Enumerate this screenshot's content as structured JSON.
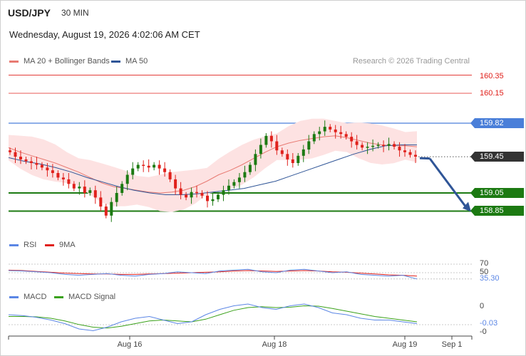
{
  "header": {
    "pair": "USD/JPY",
    "timeframe": "30 MIN",
    "datetime": "Wednesday, August 19, 2026 4:02:06 AM CET",
    "credit": "Research © 2026 Trading Central"
  },
  "legend_main": [
    {
      "label": "MA 20 + Bollinger Bands",
      "color": "#e87a72"
    },
    {
      "label": "MA 50",
      "color": "#2f5597"
    }
  ],
  "legend_rsi": [
    {
      "label": "RSI",
      "color": "#5b86e5"
    },
    {
      "label": "9MA",
      "color": "#e0211c"
    }
  ],
  "legend_macd": [
    {
      "label": "MACD",
      "color": "#5b86e5"
    },
    {
      "label": "MACD Signal",
      "color": "#3aa11a"
    }
  ],
  "levels": {
    "r2": "160.35",
    "r1": "160.15",
    "pivot": "159.82",
    "last": "159.45",
    "s1": "159.05",
    "s2": "158.85"
  },
  "rsi_panel": {
    "level_70": "70",
    "level_50": "50",
    "value": "35.30"
  },
  "macd_panel": {
    "zero": "0",
    "value": "-0.03",
    "minus": "-0"
  },
  "x_axis": [
    "Aug 16",
    "Aug 18",
    "Aug 19",
    "Sep 1"
  ],
  "colors": {
    "resistance": "#e0211c",
    "pivot": "#4a7fd9",
    "support": "#1c7a12",
    "last": "#333333",
    "arrow": "#2f5597",
    "bull": "#1c7a12",
    "bear": "#e0211c",
    "band": "#fde2e2"
  },
  "chart_data": {
    "type": "candlestick",
    "series_close": [
      159.5,
      159.45,
      159.42,
      159.4,
      159.38,
      159.36,
      159.33,
      159.3,
      159.27,
      159.22,
      159.2,
      159.15,
      159.1,
      159.12,
      159.05,
      159.08,
      159.0,
      158.9,
      158.8,
      158.95,
      159.05,
      159.15,
      159.25,
      159.32,
      159.36,
      159.35,
      159.33,
      159.36,
      159.32,
      159.28,
      159.2,
      159.1,
      159.03,
      159.0,
      159.06,
      159.05,
      159.02,
      158.96,
      158.98,
      159.03,
      159.08,
      159.13,
      159.17,
      159.22,
      159.28,
      159.36,
      159.48,
      159.58,
      159.68,
      159.62,
      159.52,
      159.48,
      159.42,
      159.38,
      159.46,
      159.53,
      159.62,
      159.7,
      159.73,
      159.78,
      159.75,
      159.72,
      159.7,
      159.67,
      159.62,
      159.58,
      159.55,
      159.56,
      159.57,
      159.58,
      159.57,
      159.59,
      159.56,
      159.52,
      159.5,
      159.47,
      159.45
    ],
    "ma20": [
      159.55,
      159.5,
      159.46,
      159.42,
      159.38,
      159.33,
      159.28,
      159.22,
      159.16,
      159.12,
      159.1,
      159.08,
      159.06,
      159.05,
      159.06,
      159.08,
      159.12,
      159.18,
      159.25,
      159.3,
      159.36,
      159.43,
      159.5,
      159.56,
      159.6,
      159.63,
      159.65,
      159.67,
      159.68,
      159.66,
      159.63,
      159.6,
      159.58,
      159.57,
      159.57,
      159.56
    ],
    "ma50": [
      159.44,
      159.4,
      159.37,
      159.33,
      159.28,
      159.22,
      159.17,
      159.12,
      159.08,
      159.05,
      159.03,
      159.03,
      159.04,
      159.06,
      159.08,
      159.1,
      159.14,
      159.18,
      159.24,
      159.3,
      159.36,
      159.42,
      159.48,
      159.53,
      159.57,
      159.58,
      159.58
    ],
    "rsi": [
      55,
      54,
      52,
      50,
      46,
      44,
      46,
      48,
      44,
      42,
      46,
      48,
      52,
      50,
      48,
      54,
      56,
      58,
      52,
      50,
      56,
      58,
      54,
      50,
      52,
      46,
      44,
      42,
      44,
      35.3
    ],
    "rsi_ma": [
      56,
      55,
      53,
      51,
      49,
      48,
      47,
      47,
      46,
      46,
      47,
      48,
      49,
      50,
      51,
      52,
      54,
      55,
      54,
      53,
      54,
      55,
      54,
      52,
      51,
      49,
      47,
      45,
      44,
      42
    ],
    "macd": [
      0.02,
      0.015,
      0.005,
      -0.01,
      -0.03,
      -0.06,
      -0.07,
      -0.05,
      -0.02,
      0.0,
      0.01,
      -0.01,
      -0.03,
      -0.02,
      0.02,
      0.05,
      0.07,
      0.08,
      0.06,
      0.05,
      0.07,
      0.08,
      0.06,
      0.03,
      0.02,
      0.0,
      -0.01,
      -0.01,
      -0.02,
      -0.03
    ],
    "macd_signal": [
      0.01,
      0.01,
      0.008,
      0.0,
      -0.015,
      -0.035,
      -0.05,
      -0.055,
      -0.045,
      -0.03,
      -0.015,
      -0.01,
      -0.015,
      -0.02,
      -0.005,
      0.02,
      0.045,
      0.06,
      0.065,
      0.06,
      0.062,
      0.07,
      0.068,
      0.055,
      0.04,
      0.025,
      0.01,
      0.0,
      -0.01,
      -0.02
    ],
    "forecast": {
      "from": 159.45,
      "to": 158.85
    },
    "ylim": [
      158.6,
      160.45
    ]
  }
}
